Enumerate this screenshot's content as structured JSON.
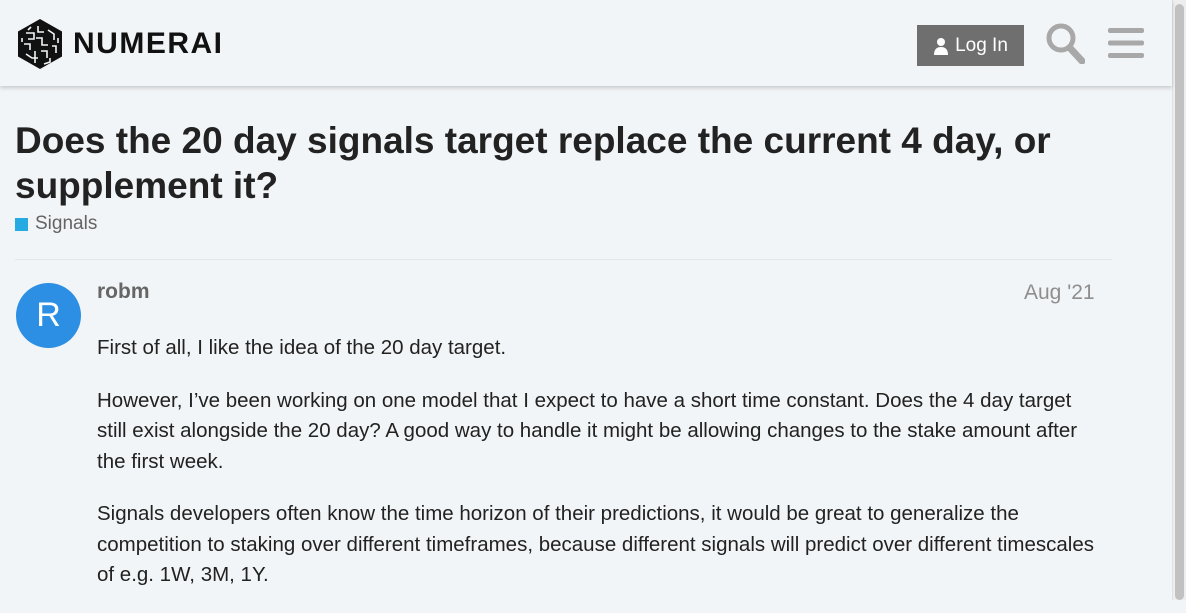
{
  "header": {
    "logo_text": "NUMERAI",
    "login_label": "Log In",
    "icons": [
      "numerai-logo-icon",
      "user-icon",
      "search-icon",
      "hamburger-menu-icon"
    ]
  },
  "topic": {
    "title": "Does the 20 day signals target replace the current 4 day, or supplement it?",
    "category": "Signals",
    "category_color": "#25aae1"
  },
  "post": {
    "avatar_letter": "R",
    "avatar_color": "#2d8fe3",
    "username": "robm",
    "date": "Aug '21",
    "paragraphs": [
      "First of all, I like the idea of the 20 day target.",
      "However, I’ve been working on one model that I expect to have a short time constant. Does the 4 day target still exist alongside the 20 day? A good way to handle it might be allowing changes to the stake amount after the first week.",
      "Signals developers often know the time horizon of their predictions, it would be great to generalize the competition to staking over different timeframes, because different signals will predict over different timescales of e.g. 1W, 3M, 1Y."
    ]
  }
}
